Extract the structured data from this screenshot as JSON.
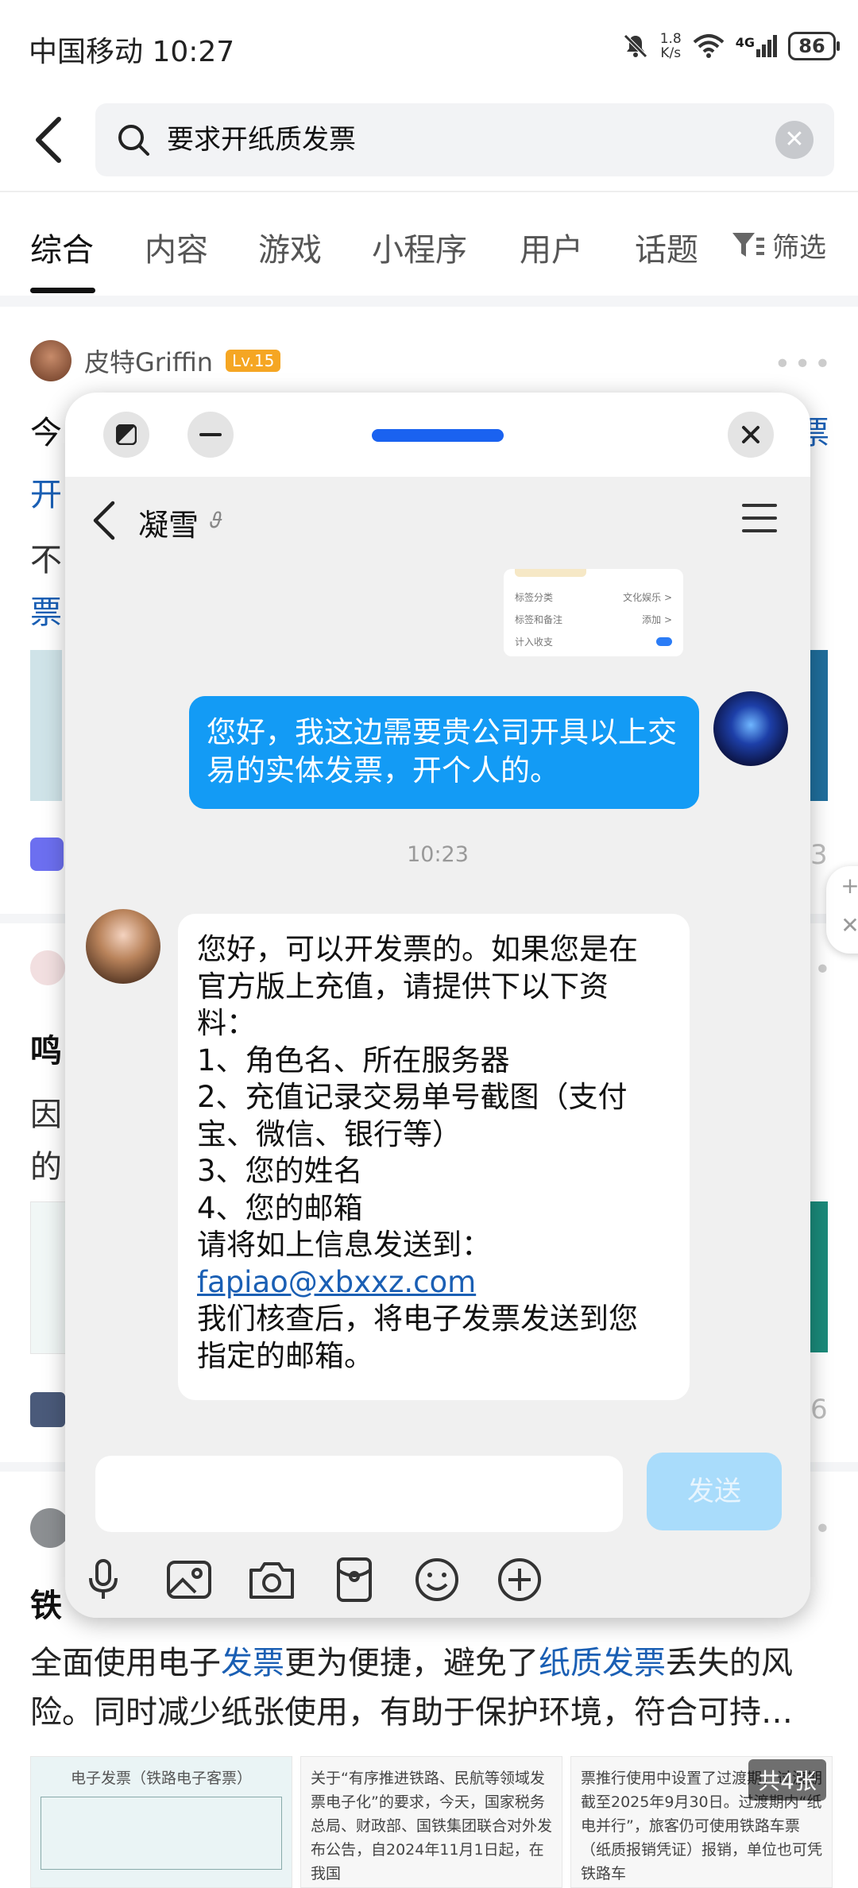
{
  "status_bar": {
    "carrier_time": "中国移动 10:27",
    "net_speed_value": "1.8",
    "net_speed_unit": "K/s",
    "network": "4G",
    "battery": "86"
  },
  "search": {
    "query": "要求开纸质发票"
  },
  "tabs": [
    "综合",
    "内容",
    "游戏",
    "小程序",
    "用户",
    "话题"
  ],
  "filter_label": "筛选",
  "feed": {
    "post1_author": "皮特Griffin",
    "post1_level": "Lv.15",
    "post1_title_left": "今",
    "post1_title_right": "票",
    "post1_line2": "开",
    "post1_line3": "不",
    "post1_line4": "票",
    "post2_title": "鸣",
    "post2_line2": "因",
    "post2_line3": "的",
    "side_num_1": "3",
    "side_num_2": "6",
    "post3_title": "铁",
    "post3_text_parts": [
      "全面使用电子",
      "发票",
      "更为便捷，避免了",
      "纸质发票",
      "丢失的风险。同时减少纸张使用，有助于保护环境，符合可持…"
    ],
    "thumb1_text": "电子发票（铁路电子客票）",
    "thumb2_text": "关于“有序推进铁路、民航等领域发票电子化”的要求，今天，国家税务总局、财政部、国铁集团联合对外发布公告，自2024年11月1日起，在我国",
    "thumb3_text": "票推行使用中设置了过渡期，过渡期截至2025年9月30日。过渡期内“纸电并行”，旅客仍可使用铁路车票（纸质报销凭证）报销，单位也可凭铁路车",
    "image_count": "共4张"
  },
  "chat": {
    "contact_name": "凝雪",
    "preview_rows": [
      {
        "label": "标签分类",
        "value": "文化娱乐 >"
      },
      {
        "label": "标签和备注",
        "value": "添加 >"
      },
      {
        "label": "计入收支",
        "value": ""
      }
    ],
    "sent_message": "您好，我这边需要贵公司开具以上交易的实体发票，开个人的。",
    "timestamp": "10:23",
    "reply_lines": [
      "您好，可以开发票的。如果您是在",
      "官方版上充值，请提供下以下资",
      "料：",
      "1、角色名、所在服务器",
      "2、充值记录交易单号截图（支付",
      "宝、微信、银行等）",
      "3、您的姓名",
      "4、您的邮箱",
      "请将如上信息发送到："
    ],
    "reply_email": "fapiao@xbxxz.com",
    "reply_tail_lines": [
      "我们核查后，将电子发票发送到您",
      "指定的邮箱。"
    ],
    "send_label": "发送"
  },
  "colors": {
    "accent_blue": "#139bf5",
    "link_blue": "#1a5fb4",
    "handle_blue": "#1a62f0",
    "level_orange": "#f5a623"
  }
}
